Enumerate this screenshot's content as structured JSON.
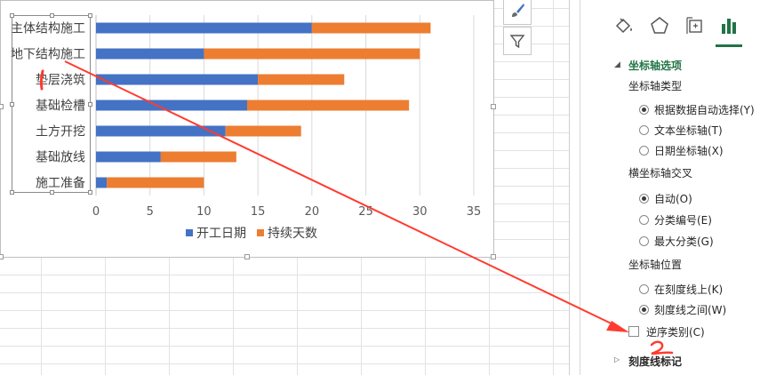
{
  "chart_data": {
    "type": "bar",
    "orientation": "horizontal",
    "stacked": true,
    "categories": [
      "主体结构施工",
      "地下结构施工",
      "垫层浇筑",
      "基础检槽",
      "土方开挖",
      "基础放线",
      "施工准备"
    ],
    "series": [
      {
        "name": "开工日期",
        "color": "#4472c4",
        "values": [
          20,
          10,
          15,
          14,
          12,
          6,
          1
        ]
      },
      {
        "name": "持续天数",
        "color": "#ed7d31",
        "values": [
          11,
          20,
          8,
          15,
          7,
          7,
          9
        ]
      }
    ],
    "xlim": [
      0,
      35
    ],
    "xticks": [
      "0",
      "5",
      "10",
      "15",
      "20",
      "25",
      "30",
      "35"
    ],
    "grid": true,
    "legend_position": "bottom"
  },
  "chart_buttons": {
    "style_icon": "brush-icon",
    "filter_icon": "funnel-icon"
  },
  "pane": {
    "tabs": [
      "fill-line-icon",
      "effects-pentagon-icon",
      "size-properties-icon",
      "axis-options-bar-icon"
    ],
    "section_axis_options": "坐标轴选项",
    "axis_type_label": "坐标轴类型",
    "axis_type_options": [
      {
        "label": "根据数据自动选择(Y)",
        "selected": true
      },
      {
        "label": "文本坐标轴(T)",
        "selected": false
      },
      {
        "label": "日期坐标轴(X)",
        "selected": false
      }
    ],
    "cross_label": "横坐标轴交叉",
    "cross_options": [
      {
        "label": "自动(O)",
        "selected": true
      },
      {
        "label": "分类编号(E)",
        "selected": false
      },
      {
        "label": "最大分类(G)",
        "selected": false
      }
    ],
    "position_label": "坐标轴位置",
    "position_options": [
      {
        "label": "在刻度线上(K)",
        "selected": false
      },
      {
        "label": "刻度线之间(W)",
        "selected": true
      }
    ],
    "reverse_order_label": "逆序类别(C)",
    "reverse_order_checked": false,
    "section_tick_marks": "刻度线标记"
  },
  "colors": {
    "accent": "#217346",
    "annotation_red": "#ff3b30"
  }
}
